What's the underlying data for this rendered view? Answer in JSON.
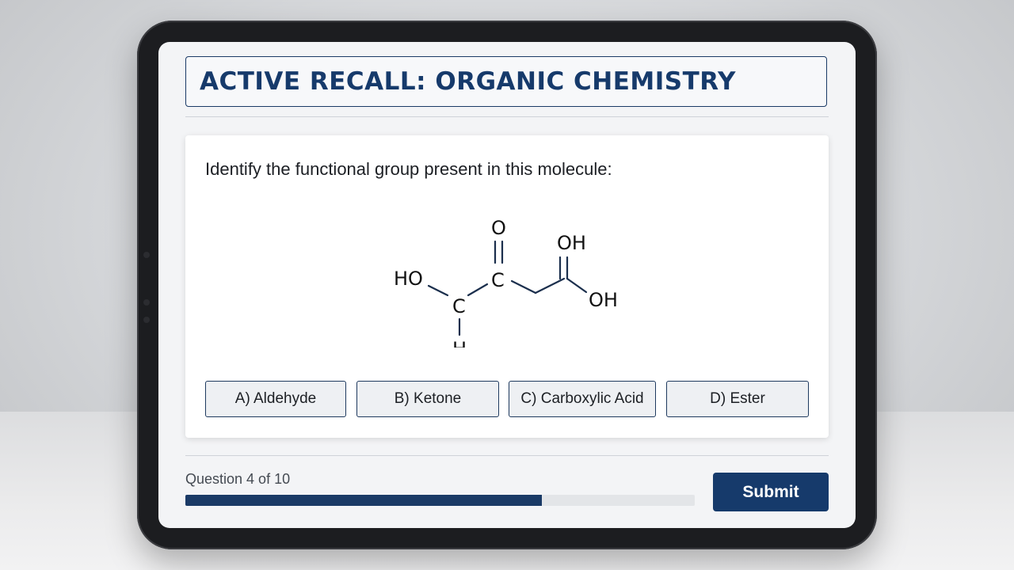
{
  "header": {
    "title": "ACTIVE RECALL: ORGANIC CHEMISTRY"
  },
  "question": {
    "prompt": "Identify the functional group present in this molecule:"
  },
  "molecule": {
    "labels": {
      "ho_left": "HO",
      "c_alpha": "C",
      "h_bottom": "H",
      "c_carbonyl": "C",
      "o_top": "O",
      "oh_top": "OH",
      "oh_right": "OH"
    }
  },
  "options": [
    {
      "label": "A) Aldehyde"
    },
    {
      "label": "B) Ketone"
    },
    {
      "label": "C) Carboxylic Acid"
    },
    {
      "label": "D) Ester"
    }
  ],
  "footer": {
    "progress_text": "Question 4 of 10",
    "progress_fraction": 0.7,
    "submit_label": "Submit"
  },
  "colors": {
    "accent": "#163a6b",
    "background": "#f3f4f6"
  }
}
